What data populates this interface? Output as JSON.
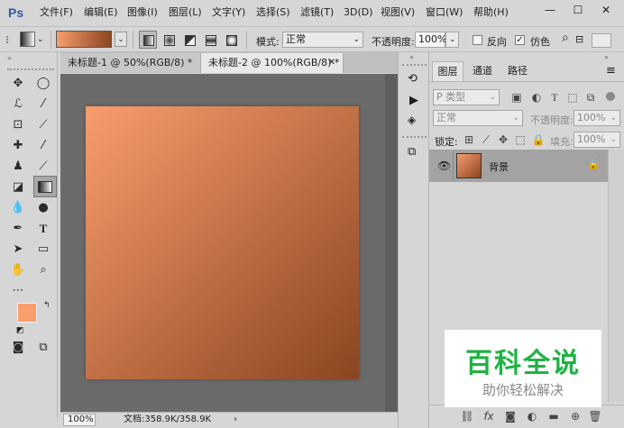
{
  "app": {
    "logo": "Ps"
  },
  "menu": [
    "文件(F)",
    "编辑(E)",
    "图像(I)",
    "图层(L)",
    "文字(Y)",
    "选择(S)",
    "滤镜(T)",
    "3D(D)",
    "视图(V)",
    "窗口(W)",
    "帮助(H)"
  ],
  "window_buttons": {
    "minimize": "—",
    "maximize": "☐",
    "close": "✕"
  },
  "options": {
    "mode_label": "模式:",
    "mode_value": "正常",
    "opacity_label": "不透明度:",
    "opacity_value": "100%",
    "reverse_label": "反向",
    "dither_label": "仿色",
    "reverse_checked": false,
    "dither_checked": true,
    "gradient_colors": [
      "#f89d6c",
      "#8b4522"
    ]
  },
  "tabs": [
    {
      "label": "未标题-1 @ 50%(RGB/8) *",
      "active": false
    },
    {
      "label": "未标题-2 @ 100%(RGB/8) *",
      "active": true
    }
  ],
  "status": {
    "zoom": "100%",
    "doc_info": "文档:358.9K/358.9K"
  },
  "colors": {
    "foreground": "#f89d6c",
    "background": "#7a3418",
    "canvas_start": "#f89d6c",
    "canvas_end": "#8b4522"
  },
  "layers_panel": {
    "tabs": [
      "图层",
      "通道",
      "路径"
    ],
    "kind_label": "P 类型",
    "blend_mode": "正常",
    "opacity_label": "不透明度:",
    "opacity_value": "100%",
    "lock_label": "锁定:",
    "fill_label": "填充:",
    "fill_value": "100%",
    "layer_name": "背景"
  },
  "watermark": {
    "title": "百科全说",
    "subtitle": "助你轻松解决"
  }
}
